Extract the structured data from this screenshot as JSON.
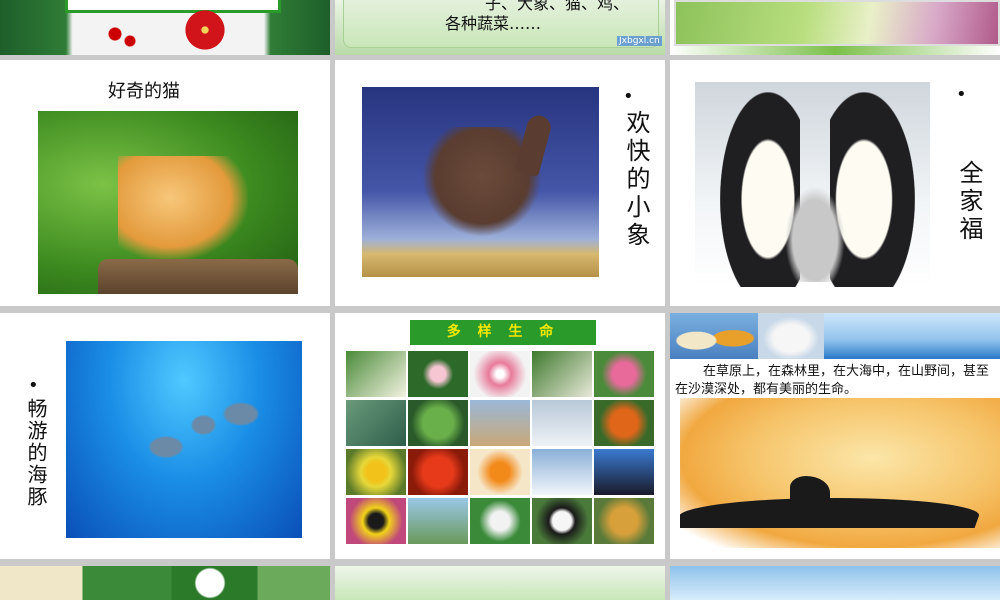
{
  "slides": {
    "top_center": {
      "text_line1": "子、大象、猫、鸡、",
      "text_line2": "各种蔬菜……",
      "watermark": "Jxbgxl.cn"
    },
    "cat": {
      "caption": "好奇的猫"
    },
    "elephant": {
      "bullet": "•",
      "caption": "欢快的小象"
    },
    "penguins": {
      "bullet": "•",
      "caption": "全家福"
    },
    "dolphins": {
      "bullet": "•",
      "caption": "畅游的海豚"
    },
    "diverse_life": {
      "title": "多 样 生 命"
    },
    "life_text": {
      "paragraph": "在草原上，在森林里，在大海中，在山野间，甚至在沙漠深处，都有美丽的生命。"
    }
  },
  "colors": {
    "green_banner": "#2a9a2a",
    "title_yellow": "#f5e800",
    "bg_gray": "#c9c9c9"
  }
}
